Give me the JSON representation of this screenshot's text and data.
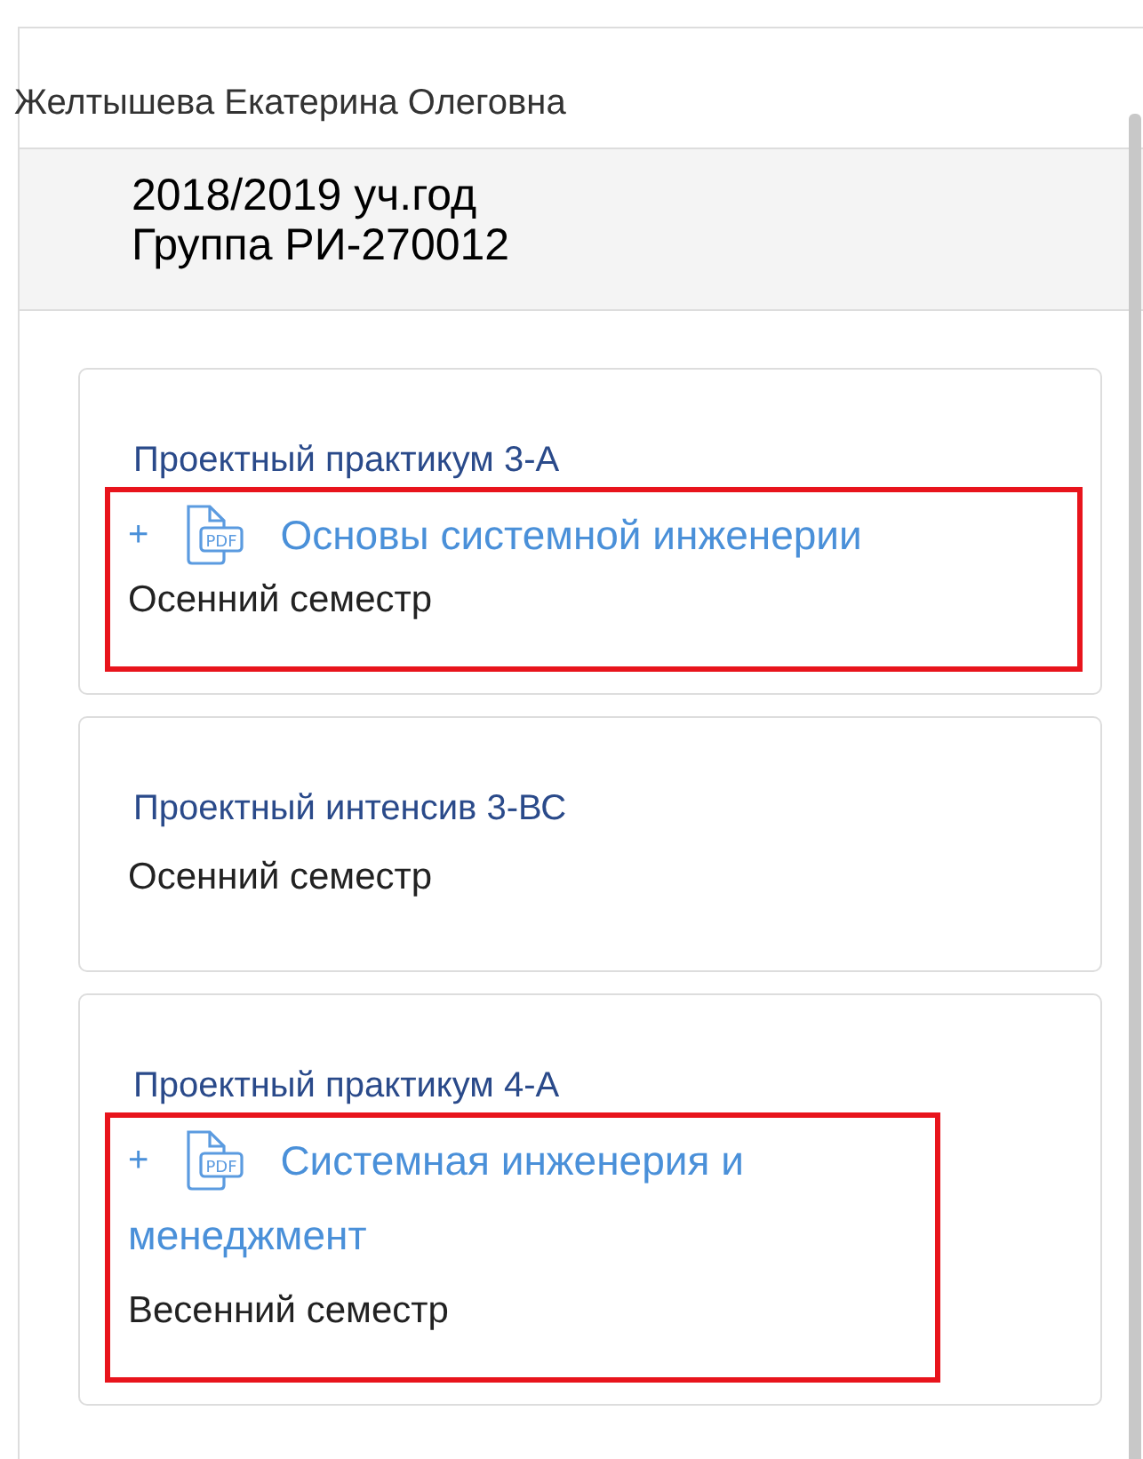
{
  "student": {
    "name": "Желтышева Екатерина Олеговна"
  },
  "header": {
    "year": "2018/2019 уч.год",
    "group": "Группа РИ-270012"
  },
  "courses": [
    {
      "title": "Проектный практикум 3-А",
      "file": {
        "marker": "+",
        "type": "PDF",
        "name_lines": [
          "Основы системной инженерии"
        ]
      },
      "semester": "Осенний семестр",
      "highlighted": true
    },
    {
      "title": "Проектный интенсив 3-ВС",
      "semester": "Осенний семестр",
      "highlighted": false
    },
    {
      "title": "Проектный практикум 4-А",
      "file": {
        "marker": "+",
        "type": "PDF",
        "name_lines": [
          "Системная инженерия и",
          "менеджмент"
        ]
      },
      "semester": "Весенний семестр",
      "highlighted": true
    }
  ]
}
